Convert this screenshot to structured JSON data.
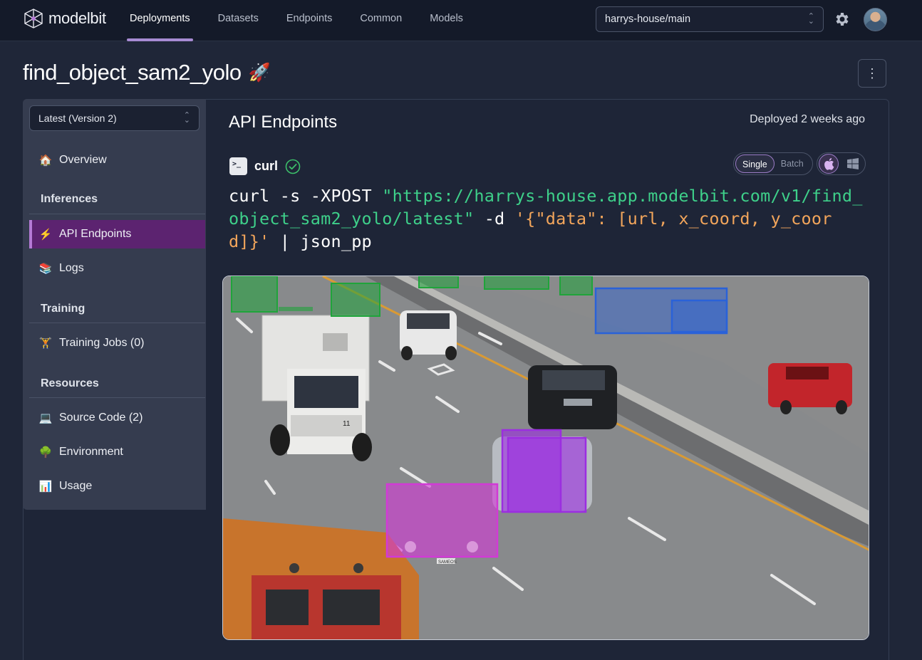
{
  "app": {
    "brand": "modelbit"
  },
  "nav": {
    "items": [
      {
        "label": "Deployments",
        "active": true
      },
      {
        "label": "Datasets"
      },
      {
        "label": "Endpoints"
      },
      {
        "label": "Common"
      },
      {
        "label": "Models"
      }
    ]
  },
  "branch": {
    "value": "harrys-house/main"
  },
  "page": {
    "title": "find_object_sam2_yolo",
    "title_emoji": "🚀"
  },
  "sidebar": {
    "version": "Latest (Version 2)",
    "overview": {
      "icon": "house-icon",
      "label": "Overview"
    },
    "sections": {
      "inferences": "Inferences",
      "training": "Training",
      "resources": "Resources"
    },
    "items": {
      "api_endpoints": {
        "icon": "lightning-icon",
        "label": "API Endpoints"
      },
      "logs": {
        "icon": "books-icon",
        "label": "Logs"
      },
      "training_jobs": {
        "icon": "weightlifter-icon",
        "label": "Training Jobs (0)"
      },
      "source_code": {
        "icon": "laptop-icon",
        "label": "Source Code (2)"
      },
      "environment": {
        "icon": "tree-icon",
        "label": "Environment"
      },
      "usage": {
        "icon": "bar-chart-icon",
        "label": "Usage"
      }
    }
  },
  "content": {
    "title": "API Endpoints",
    "deployed": "Deployed 2 weeks ago",
    "client": {
      "label": "curl",
      "verified": true
    },
    "mode_toggle": {
      "options": [
        "Single",
        "Batch"
      ],
      "selected": "Single"
    },
    "os_toggle": {
      "options": [
        "apple-icon",
        "windows-icon"
      ],
      "selected": "apple-icon"
    },
    "command": {
      "prefix": "curl -s -XPOST ",
      "url": "\"https://harrys-house.app.modelbit.com/v1/find_object_sam2_yolo/latest\"",
      "flag": " -d ",
      "payload": "'{\"data\": [url, x_coord, y_coord]}'",
      "suffix": " | json_pp"
    }
  },
  "image": {
    "description_icon": "highway-segmentation-image",
    "plate_text": "SAMEOS",
    "truck_number": "11",
    "colors": {
      "green": "#1fa43a",
      "blue": "#2a62d8",
      "purple": "#9b2ee0",
      "magenta": "#d23ad6"
    }
  }
}
